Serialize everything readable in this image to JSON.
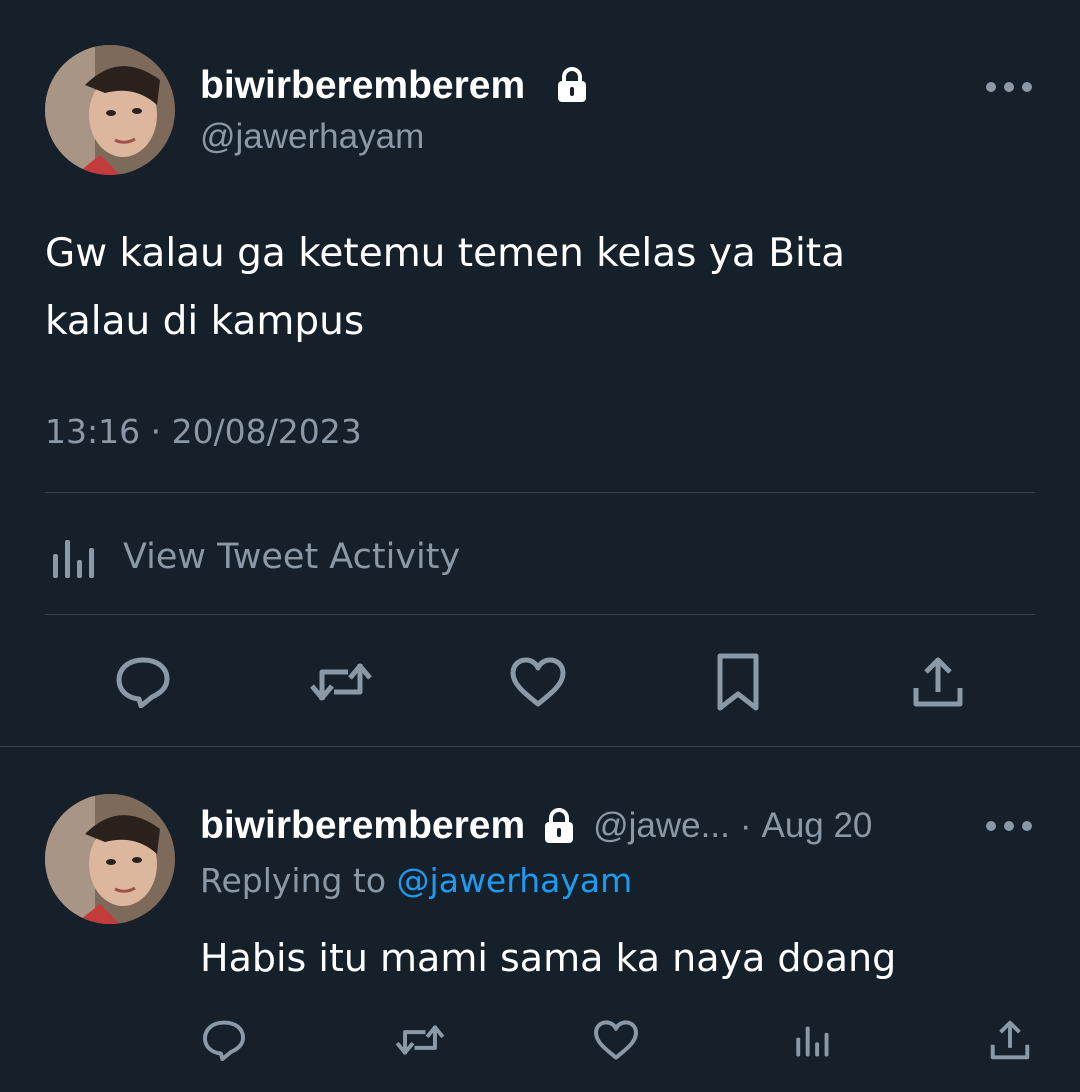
{
  "main_tweet": {
    "display_name": "biwirberemberem",
    "handle": "@jawerhayam",
    "avatar_icon": "profile-photo",
    "protected_icon": "lock-icon",
    "more_icon": "more-dots-icon",
    "text_line1": "Gw kalau ga ketemu temen kelas ya Bita",
    "text_line2": "kalau di kampus",
    "timestamp": "13:16 · 20/08/2023",
    "activity_label": "View Tweet Activity",
    "actions": [
      "reply-icon",
      "retweet-icon",
      "like-icon",
      "bookmark-icon",
      "share-icon"
    ]
  },
  "reply_tweet": {
    "display_name": "biwirberemberem",
    "handle_truncated": "@jawe...",
    "separator": "·",
    "date": "Aug 20",
    "replying_prefix": "Replying to",
    "replying_to": "@jawerhayam",
    "text": "Habis itu mami sama ka naya doang",
    "actions": [
      "reply-icon",
      "retweet-icon",
      "like-icon",
      "analytics-icon",
      "share-icon"
    ]
  },
  "colors": {
    "background": "#15202b",
    "primary_text": "#ffffff",
    "secondary_text": "#8b98a5",
    "divider": "#38444d",
    "link": "#1d9bf0"
  }
}
